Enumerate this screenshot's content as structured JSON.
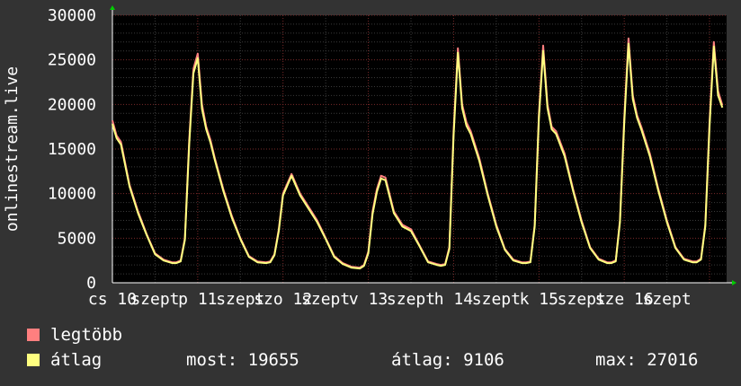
{
  "chart_data": {
    "type": "line",
    "ylabel": "onlinestream.live",
    "ylim": [
      0,
      30000
    ],
    "yticks": [
      0,
      5000,
      10000,
      15000,
      20000,
      25000,
      30000
    ],
    "grid": true,
    "xlim": [
      0,
      7.2
    ],
    "x_tick_labels": [
      {
        "x": 0.0,
        "label": "cs 10"
      },
      {
        "x": 0.5,
        "label": "szept"
      },
      {
        "x": 1.0,
        "label": "p 11"
      },
      {
        "x": 1.5,
        "label": "szept"
      },
      {
        "x": 2.0,
        "label": "szo 12"
      },
      {
        "x": 2.5,
        "label": "szept"
      },
      {
        "x": 3.0,
        "label": "v 13"
      },
      {
        "x": 3.5,
        "label": "szept"
      },
      {
        "x": 4.0,
        "label": "h 14"
      },
      {
        "x": 4.5,
        "label": "szept"
      },
      {
        "x": 5.0,
        "label": "k 15"
      },
      {
        "x": 5.5,
        "label": "szept"
      },
      {
        "x": 6.0,
        "label": "sze 16"
      },
      {
        "x": 6.5,
        "label": "szept"
      }
    ],
    "series": [
      {
        "name": "legtöbb",
        "color": "#ff7f7f",
        "x": [
          0,
          0.05,
          0.1,
          0.2,
          0.3,
          0.4,
          0.5,
          0.6,
          0.7,
          0.75,
          0.8,
          0.85,
          0.9,
          0.95,
          1.0,
          1.05,
          1.1,
          1.15,
          1.2,
          1.3,
          1.4,
          1.5,
          1.6,
          1.7,
          1.8,
          1.85,
          1.9,
          1.95,
          2.0,
          2.1,
          2.2,
          2.3,
          2.4,
          2.5,
          2.6,
          2.7,
          2.8,
          2.9,
          2.95,
          3.0,
          3.05,
          3.1,
          3.15,
          3.2,
          3.3,
          3.4,
          3.5,
          3.6,
          3.7,
          3.8,
          3.85,
          3.9,
          3.95,
          4.0,
          4.05,
          4.1,
          4.15,
          4.2,
          4.3,
          4.4,
          4.5,
          4.6,
          4.7,
          4.8,
          4.85,
          4.9,
          4.95,
          5.0,
          5.05,
          5.1,
          5.15,
          5.2,
          5.3,
          5.4,
          5.5,
          5.6,
          5.7,
          5.8,
          5.85,
          5.9,
          5.95,
          6.0,
          6.05,
          6.1,
          6.15,
          6.2,
          6.3,
          6.4,
          6.5,
          6.6,
          6.7,
          6.8,
          6.85,
          6.9,
          6.95,
          7.0,
          7.05,
          7.1,
          7.15
        ],
        "values": [
          18200,
          16500,
          15800,
          11000,
          8000,
          5500,
          3300,
          2600,
          2300,
          2300,
          2500,
          5000,
          16000,
          24000,
          25700,
          20000,
          17500,
          16000,
          14000,
          10500,
          7500,
          5000,
          3000,
          2400,
          2300,
          2400,
          3200,
          6000,
          10000,
          12200,
          10000,
          8500,
          7000,
          5000,
          3000,
          2200,
          1800,
          1700,
          2000,
          3500,
          8000,
          10500,
          12000,
          11800,
          8000,
          6500,
          6000,
          4200,
          2400,
          2100,
          2000,
          2100,
          4000,
          17000,
          26300,
          20000,
          18000,
          17000,
          14000,
          10000,
          6500,
          3800,
          2600,
          2300,
          2300,
          2400,
          6500,
          19000,
          26600,
          20000,
          17500,
          17000,
          14500,
          10500,
          7000,
          4000,
          2700,
          2300,
          2300,
          2500,
          7000,
          18500,
          27400,
          21000,
          18800,
          17500,
          14500,
          10500,
          7000,
          4000,
          2700,
          2400,
          2400,
          2700,
          6500,
          18000,
          27000,
          21500,
          19900
        ]
      },
      {
        "name": "átlag",
        "color": "#ffff80",
        "x": [
          0,
          0.05,
          0.1,
          0.2,
          0.3,
          0.4,
          0.5,
          0.6,
          0.7,
          0.75,
          0.8,
          0.85,
          0.9,
          0.95,
          1.0,
          1.05,
          1.1,
          1.15,
          1.2,
          1.3,
          1.4,
          1.5,
          1.6,
          1.7,
          1.8,
          1.85,
          1.9,
          1.95,
          2.0,
          2.1,
          2.2,
          2.3,
          2.4,
          2.5,
          2.6,
          2.7,
          2.8,
          2.9,
          2.95,
          3.0,
          3.05,
          3.1,
          3.15,
          3.2,
          3.3,
          3.4,
          3.5,
          3.6,
          3.7,
          3.8,
          3.85,
          3.9,
          3.95,
          4.0,
          4.05,
          4.1,
          4.15,
          4.2,
          4.3,
          4.4,
          4.5,
          4.6,
          4.7,
          4.8,
          4.85,
          4.9,
          4.95,
          5.0,
          5.05,
          5.1,
          5.15,
          5.2,
          5.3,
          5.4,
          5.5,
          5.6,
          5.7,
          5.8,
          5.85,
          5.9,
          5.95,
          6.0,
          6.05,
          6.1,
          6.15,
          6.2,
          6.3,
          6.4,
          6.5,
          6.6,
          6.7,
          6.8,
          6.85,
          6.9,
          6.95,
          7.0,
          7.05,
          7.1,
          7.15
        ],
        "values": [
          17800,
          16200,
          15500,
          10800,
          7800,
          5400,
          3200,
          2500,
          2200,
          2200,
          2400,
          4800,
          15500,
          23500,
          25200,
          19500,
          17200,
          15700,
          13800,
          10300,
          7300,
          4900,
          2900,
          2300,
          2200,
          2300,
          3100,
          5800,
          9800,
          12000,
          9800,
          8300,
          6800,
          4900,
          2900,
          2100,
          1700,
          1600,
          1900,
          3300,
          7700,
          10200,
          11700,
          11500,
          7800,
          6300,
          5800,
          4100,
          2300,
          2000,
          1900,
          2000,
          3800,
          16500,
          25800,
          19600,
          17600,
          16700,
          13700,
          9800,
          6300,
          3700,
          2500,
          2200,
          2200,
          2300,
          6300,
          18500,
          26000,
          19600,
          17200,
          16700,
          14200,
          10300,
          6800,
          3900,
          2600,
          2200,
          2200,
          2400,
          6800,
          18000,
          26800,
          20600,
          18500,
          17200,
          14200,
          10300,
          6800,
          3900,
          2600,
          2300,
          2300,
          2600,
          6300,
          17500,
          26500,
          21000,
          19655
        ]
      }
    ]
  },
  "legend": {
    "max_label": "legtöbb",
    "avg_label": "átlag",
    "max_color": "#ff7f7f",
    "avg_color": "#ffff80"
  },
  "stats": {
    "current": "most: 19655",
    "average": "átlag: 9106",
    "maximum": "max: 27016"
  }
}
